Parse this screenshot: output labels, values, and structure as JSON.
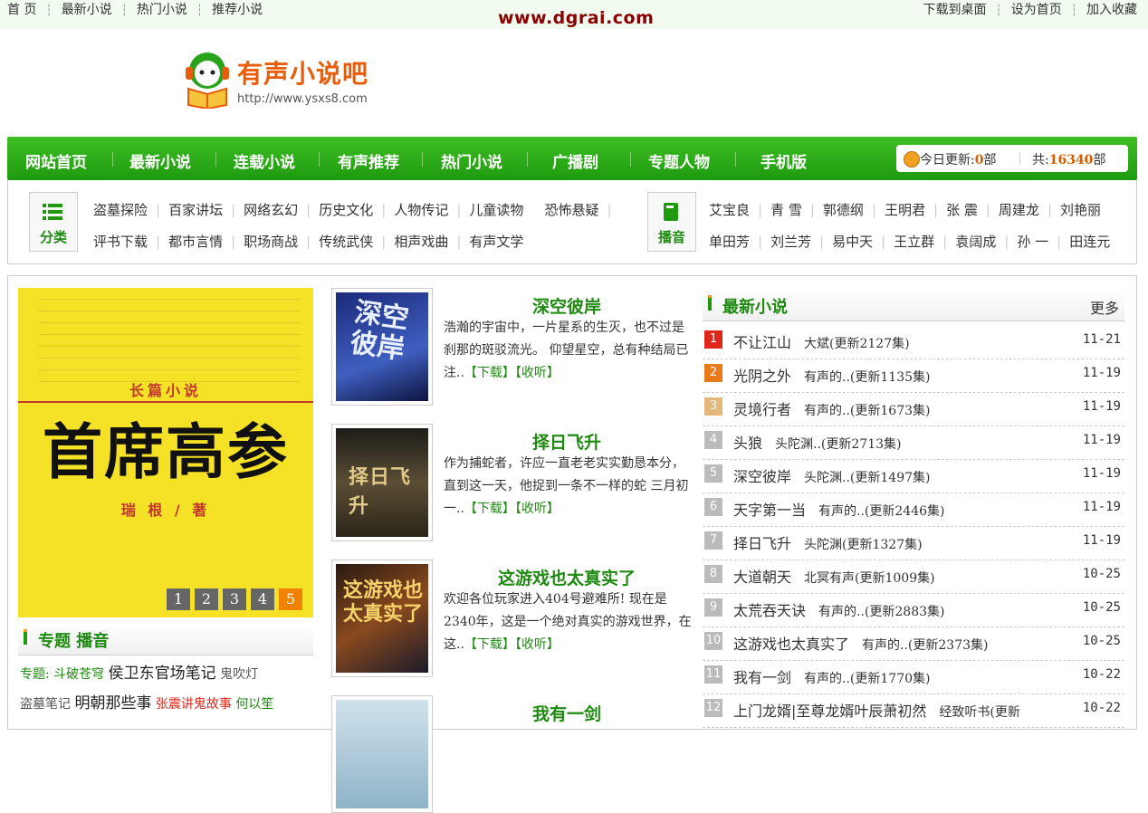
{
  "topbar": {
    "left": [
      "首 页",
      "最新小说",
      "热门小说",
      "推荐小说"
    ],
    "site": "www.dgrai.com",
    "right": [
      "下载到桌面",
      "设为首页",
      "加入收藏"
    ]
  },
  "logo": {
    "name": "有声小说吧",
    "url": "http://www.ysxs8.com"
  },
  "nav": {
    "items": [
      "网站首页",
      "最新小说",
      "连载小说",
      "有声推荐",
      "热门小说",
      "广播剧",
      "专题人物",
      "手机版"
    ],
    "today_label": "今日更新:",
    "today_value": "0",
    "today_unit": "部",
    "total_label": "共:",
    "total_value": "16340",
    "total_unit": "部"
  },
  "categories": {
    "label": "分类",
    "row1": [
      "盗墓探险",
      "百家讲坛",
      "网络玄幻",
      "历史文化",
      "人物传记",
      "儿童读物",
      "恐怖悬疑"
    ],
    "row2": [
      "评书下载",
      "都市言情",
      "职场商战",
      "传统武侠",
      "相声戏曲",
      "有声文学"
    ]
  },
  "hosts": {
    "label": "播音",
    "row1": [
      "艾宝良",
      "青 雪",
      "郭德纲",
      "王明君",
      "张 震",
      "周建龙",
      "刘艳丽"
    ],
    "row2": [
      "单田芳",
      "刘兰芳",
      "易中天",
      "王立群",
      "袁阔成",
      "孙 一",
      "田连元"
    ]
  },
  "slider": {
    "series": "长篇小说",
    "title": "首席高参",
    "author": "瑞 根 / 著",
    "pages": [
      "1",
      "2",
      "3",
      "4",
      "5"
    ],
    "active_page": "5"
  },
  "special": {
    "title": "专题 播音",
    "line1_label": "专题:",
    "line1": [
      {
        "text": "斗破苍穹",
        "style": "green"
      },
      {
        "text": "侯卫东官场笔记",
        "style": "big"
      },
      {
        "text": "鬼吹灯",
        "style": "gray"
      }
    ],
    "line2": [
      {
        "text": "盗墓笔记",
        "style": "gray"
      },
      {
        "text": "明朝那些事",
        "style": "big"
      },
      {
        "text": "张震讲鬼故事",
        "style": "red"
      },
      {
        "text": "何以笙",
        "style": "green"
      }
    ]
  },
  "features": [
    {
      "title": "深空彼岸",
      "desc": "浩瀚的宇宙中，一片星系的生灭，也不过是刹那的斑驳流光。 仰望星空，总有种结局已注..",
      "download": "【下载】",
      "listen": "【收听】",
      "cover_text": "深空彼岸",
      "color": "#2b3f9e"
    },
    {
      "title": "择日飞升",
      "desc": "作为捕蛇者，许应一直老老实实勤恳本分，直到这一天，他捉到一条不一样的蛇 三月初一..",
      "download": "【下载】",
      "listen": "【收听】",
      "cover_text": "择日飞升",
      "color": "#3a3326"
    },
    {
      "title": "这游戏也太真实了",
      "desc": "欢迎各位玩家进入404号避难所! 现在是2340年，这是一个绝对真实的游戏世界，在这..",
      "download": "【下载】",
      "listen": "【收听】",
      "cover_text": "这游戏也太真实了",
      "color": "#5a2e1c"
    },
    {
      "title": "我有一剑",
      "desc": "",
      "download": "",
      "listen": "",
      "cover_text": "",
      "color": "#8fb3c8"
    }
  ],
  "latest": {
    "title": "最新小说",
    "more": "更多",
    "items": [
      {
        "num": "1",
        "name": "不让江山",
        "info": "大斌(更新2127集)",
        "date": "11-21",
        "color": "#e0261a"
      },
      {
        "num": "2",
        "name": "光阴之外",
        "info": "有声的..(更新1135集)",
        "date": "11-19",
        "color": "#e87a1a"
      },
      {
        "num": "3",
        "name": "灵境行者",
        "info": "有声的..(更新1673集)",
        "date": "11-19",
        "color": "#e5b77a"
      },
      {
        "num": "4",
        "name": "头狼",
        "info": "头陀渊..(更新2713集)",
        "date": "11-19",
        "color": "#bbbbbb"
      },
      {
        "num": "5",
        "name": "深空彼岸",
        "info": "头陀渊..(更新1497集)",
        "date": "11-19",
        "color": "#bbbbbb"
      },
      {
        "num": "6",
        "name": "天字第一当",
        "info": "有声的..(更新2446集)",
        "date": "11-19",
        "color": "#bbbbbb"
      },
      {
        "num": "7",
        "name": "择日飞升",
        "info": "头陀渊(更新1327集)",
        "date": "11-19",
        "color": "#bbbbbb"
      },
      {
        "num": "8",
        "name": "大道朝天",
        "info": "北冥有声(更新1009集)",
        "date": "10-25",
        "color": "#bbbbbb"
      },
      {
        "num": "9",
        "name": "太荒吞天诀",
        "info": "有声的..(更新2883集)",
        "date": "10-25",
        "color": "#bbbbbb"
      },
      {
        "num": "10",
        "name": "这游戏也太真实了",
        "info": "有声的..(更新2373集)",
        "date": "10-25",
        "color": "#bbbbbb"
      },
      {
        "num": "11",
        "name": "我有一剑",
        "info": "有声的..(更新1770集)",
        "date": "10-22",
        "color": "#bbbbbb"
      },
      {
        "num": "12",
        "name": "上门龙婿|至尊龙婿叶辰萧初然",
        "info": "经致听书(更新",
        "date": "10-22",
        "color": "#bbbbbb"
      }
    ]
  }
}
